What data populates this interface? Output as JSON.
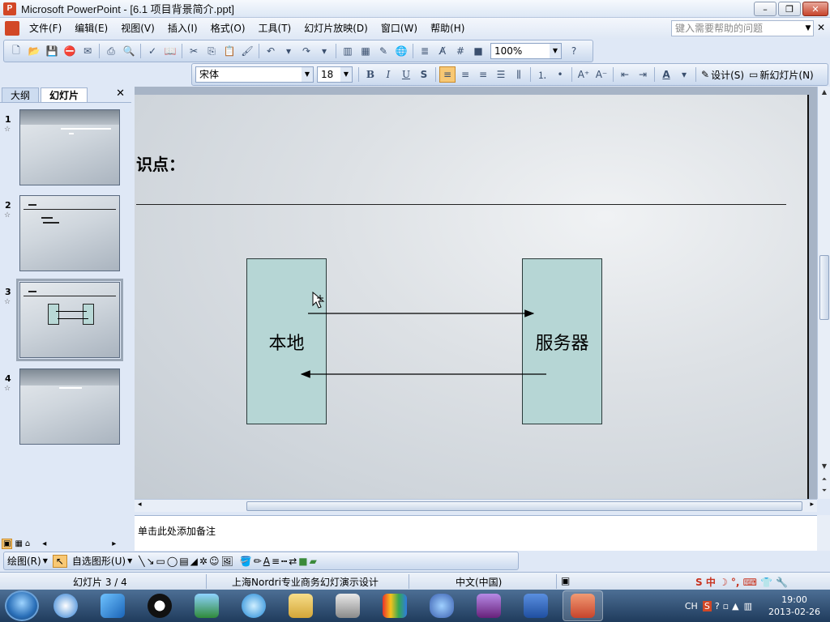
{
  "window": {
    "title": "Microsoft PowerPoint - [6.1 项目背景简介.ppt]",
    "app_icon": "P"
  },
  "menu": {
    "items": [
      "文件(F)",
      "编辑(E)",
      "视图(V)",
      "插入(I)",
      "格式(O)",
      "工具(T)",
      "幻灯片放映(D)",
      "窗口(W)",
      "帮助(H)"
    ],
    "help_placeholder": "键入需要帮助的问题"
  },
  "toolbar": {
    "zoom": "100%",
    "font_name": "宋体",
    "font_size": "18",
    "design_label": "设计(S)",
    "new_slide_label": "新幻灯片(N)"
  },
  "left_pane": {
    "tabs": [
      "大纲",
      "幻灯片"
    ],
    "slides": [
      {
        "number": "1",
        "star": "☆"
      },
      {
        "number": "2",
        "star": "☆"
      },
      {
        "number": "3",
        "star": "☆"
      },
      {
        "number": "4",
        "star": "☆"
      }
    ]
  },
  "slide": {
    "title_fragment": "识点：",
    "box_left_label": "本地",
    "box_right_label": "服务器"
  },
  "notes": {
    "placeholder": "单击此处添加备注"
  },
  "draw_toolbar": {
    "draw_label": "绘图(R)",
    "autoshape_label": "自选图形(U)"
  },
  "status": {
    "slide_position": "幻灯片 3 / 4",
    "design_name": "上海Nordri专业商务幻灯演示设计",
    "language": "中文(中国)"
  },
  "taskbar": {
    "ime": "CH",
    "time": "19:00",
    "date": "2013-02-26"
  },
  "colors": {
    "accent": "#d24726",
    "box_fill": "#b6d6d5",
    "taskbar": "#1f3b5c"
  }
}
